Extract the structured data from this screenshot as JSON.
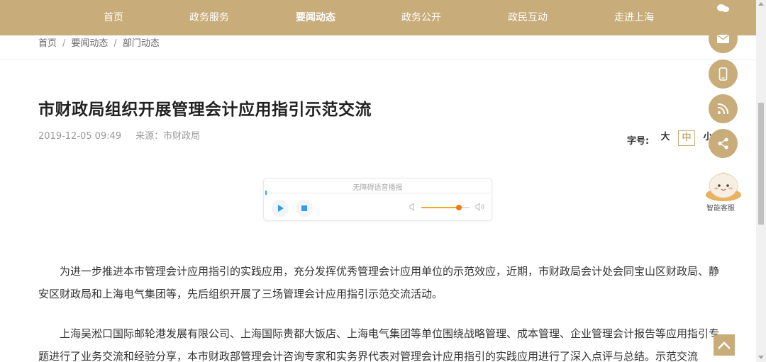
{
  "nav": {
    "items": [
      {
        "label": "首页"
      },
      {
        "label": "政务服务"
      },
      {
        "label": "要闻动态"
      },
      {
        "label": "政务公开"
      },
      {
        "label": "政民互动"
      },
      {
        "label": "走进上海"
      }
    ],
    "active": "要闻动态"
  },
  "breadcrumb": {
    "items": [
      "首页",
      "要闻动态",
      "部门动态"
    ],
    "separator": "/"
  },
  "article": {
    "title": "市财政局组织开展管理会计应用指引示范交流",
    "date": "2019-12-05 09:49",
    "source": "来源：市财政局",
    "paragraphs": [
      "为进一步推进本市管理会计应用指引的实践应用，充分发挥优秀管理会计应用单位的示范效应，近期，市财政局会计处会同宝山区财政局、静安区财政局和上海电气集团等，先后组织开展了三场管理会计应用指引示范交流活动。",
      "上海吴淞口国际邮轮港发展有限公司、上海国际贵都大饭店、上海电气集团等单位围绕战略管理、成本管理、企业管理会计报告等应用指引专题进行了业务交流和经验分享，本市财政部管理会计咨询专家和实务界代表对管理会计应用指引的实践应用进行了深入点评与总结。示范交流"
    ]
  },
  "font_size": {
    "label": "字号:",
    "options": [
      "大",
      "中",
      "小"
    ],
    "selected": "中"
  },
  "player": {
    "title": "无障碍语音播报",
    "volume_level": 0.78
  },
  "sidebar": {
    "buttons": [
      "wechat-icon",
      "mail-icon",
      "mobile-icon",
      "rss-icon",
      "share-icon"
    ],
    "bot_label": "智能客服"
  },
  "colors": {
    "brand": "#c8ac79",
    "accent_blue": "#2f9de8",
    "accent_orange": "#f07c18"
  }
}
